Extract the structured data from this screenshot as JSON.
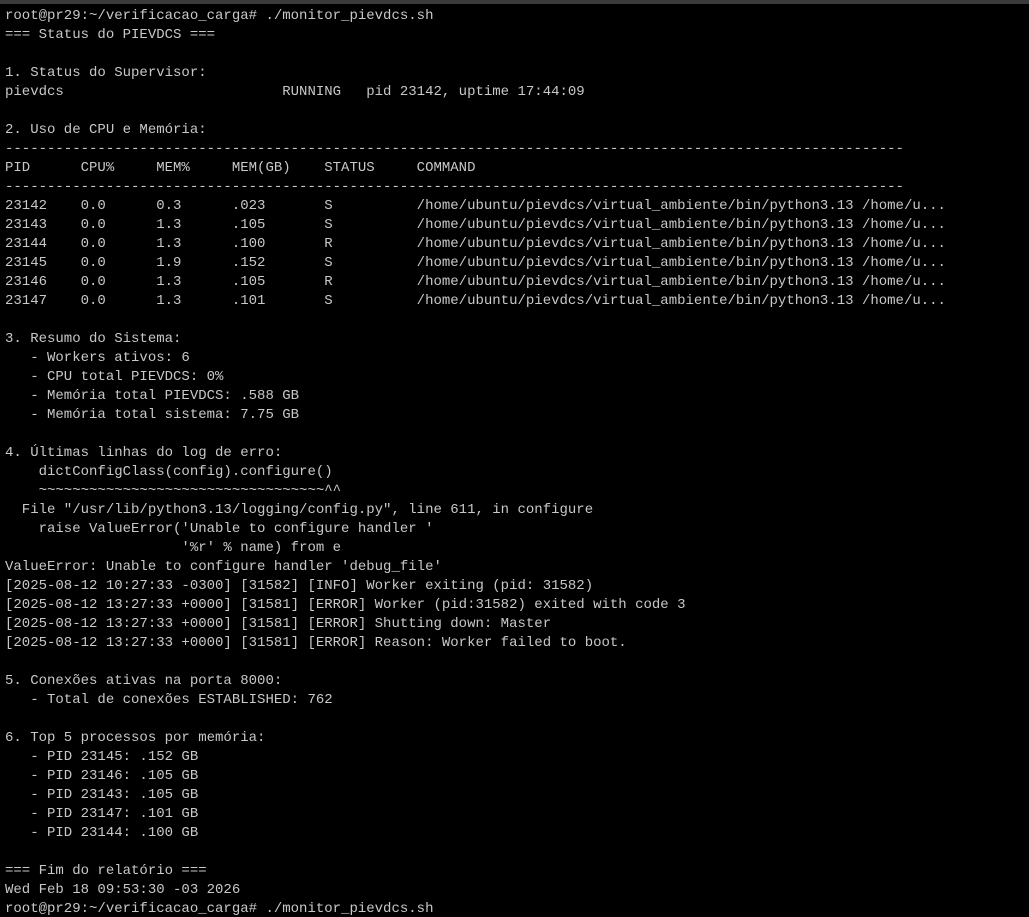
{
  "terminal": {
    "lines": [
      "root@pr29:~/verificacao_carga# ./monitor_pievdcs.sh",
      "=== Status do PIEVDCS ===",
      "",
      "1. Status do Supervisor:",
      "pievdcs                          RUNNING   pid 23142, uptime 17:44:09",
      "",
      "2. Uso de CPU e Memória:",
      "-----------------------------------------------------------------------------------------------------------",
      "PID      CPU%     MEM%     MEM(GB)    STATUS     COMMAND",
      "-----------------------------------------------------------------------------------------------------------",
      "23142    0.0      0.3      .023       S          /home/ubuntu/pievdcs/virtual_ambiente/bin/python3.13 /home/u...",
      "23143    0.0      1.3      .105       S          /home/ubuntu/pievdcs/virtual_ambiente/bin/python3.13 /home/u...",
      "23144    0.0      1.3      .100       R          /home/ubuntu/pievdcs/virtual_ambiente/bin/python3.13 /home/u...",
      "23145    0.0      1.9      .152       S          /home/ubuntu/pievdcs/virtual_ambiente/bin/python3.13 /home/u...",
      "23146    0.0      1.3      .105       R          /home/ubuntu/pievdcs/virtual_ambiente/bin/python3.13 /home/u...",
      "23147    0.0      1.3      .101       S          /home/ubuntu/pievdcs/virtual_ambiente/bin/python3.13 /home/u...",
      "",
      "3. Resumo do Sistema:",
      "   - Workers ativos: 6",
      "   - CPU total PIEVDCS: 0%",
      "   - Memória total PIEVDCS: .588 GB",
      "   - Memória total sistema: 7.75 GB",
      "",
      "4. Últimas linhas do log de erro:",
      "    dictConfigClass(config).configure()",
      "    ~~~~~~~~~~~~~~~~~~~~~~~~~~~~~~~~~~^^",
      "  File \"/usr/lib/python3.13/logging/config.py\", line 611, in configure",
      "    raise ValueError('Unable to configure handler '",
      "                     '%r' % name) from e",
      "ValueError: Unable to configure handler 'debug_file'",
      "[2025-08-12 10:27:33 -0300] [31582] [INFO] Worker exiting (pid: 31582)",
      "[2025-08-12 13:27:33 +0000] [31581] [ERROR] Worker (pid:31582) exited with code 3",
      "[2025-08-12 13:27:33 +0000] [31581] [ERROR] Shutting down: Master",
      "[2025-08-12 13:27:33 +0000] [31581] [ERROR] Reason: Worker failed to boot.",
      "",
      "5. Conexões ativas na porta 8000:",
      "   - Total de conexões ESTABLISHED: 762",
      "",
      "6. Top 5 processos por memória:",
      "   - PID 23145: .152 GB",
      "   - PID 23146: .105 GB",
      "   - PID 23143: .105 GB",
      "   - PID 23147: .101 GB",
      "   - PID 23144: .100 GB",
      "",
      "=== Fim do relatório ===",
      "Wed Feb 18 09:53:30 -03 2026",
      "root@pr29:~/verificacao_carga# ./monitor_pievdcs.sh"
    ],
    "colors": {
      "background": "#000000",
      "foreground": "#c8c8c8",
      "titlebar": "#3a3a3a"
    }
  }
}
